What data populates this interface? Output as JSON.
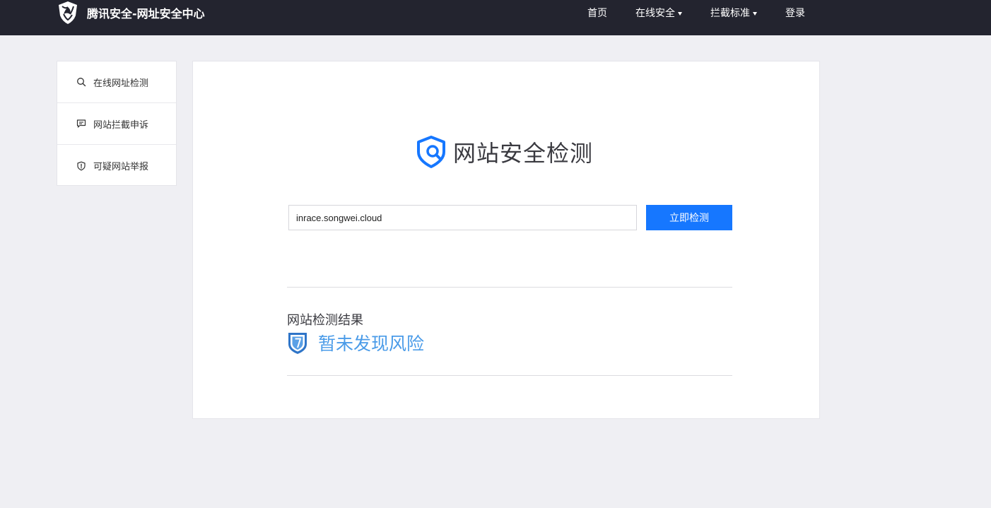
{
  "header": {
    "brand": "腾讯安全-网址安全中心",
    "nav": [
      {
        "label": "首页",
        "dropdown": false
      },
      {
        "label": "在线安全",
        "dropdown": true
      },
      {
        "label": "拦截标准",
        "dropdown": true
      },
      {
        "label": "登录",
        "dropdown": false
      }
    ]
  },
  "sidebar": {
    "items": [
      {
        "label": "在线网址检测",
        "icon": "search-icon"
      },
      {
        "label": "网站拦截申诉",
        "icon": "message-icon"
      },
      {
        "label": "可疑网站举报",
        "icon": "shield-alert-icon"
      }
    ]
  },
  "main": {
    "title": "网站安全检测",
    "search": {
      "value": "inrace.songwei.cloud",
      "placeholder": ""
    },
    "check_button": "立即检测",
    "result_label": "网站检测结果",
    "result_text": "暂未发现风险"
  },
  "colors": {
    "topbar": "#23242f",
    "background": "#efeff3",
    "primary": "#1677ff",
    "result": "#4a9be8"
  }
}
